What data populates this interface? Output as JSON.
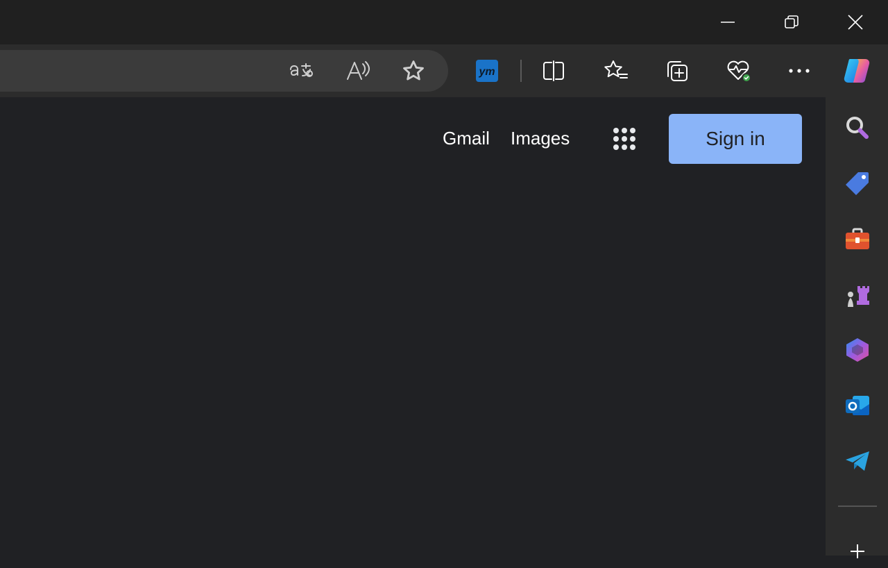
{
  "window_controls": {
    "minimize_icon": "minimize-icon",
    "restore_icon": "restore-icon",
    "close_icon": "close-icon"
  },
  "toolbar": {
    "address_icons": [
      "translate-icon",
      "read-aloud-icon",
      "favorite-star-icon"
    ],
    "extension": {
      "label": "ym",
      "color": "#1a73c8"
    },
    "icons": [
      "split-screen-icon",
      "favorites-icon",
      "collections-icon",
      "browser-essentials-icon",
      "more-icon",
      "copilot-icon"
    ]
  },
  "page": {
    "links": {
      "gmail": "Gmail",
      "images": "Images"
    },
    "apps_icon": "google-apps-icon",
    "sign_in_label": "Sign in",
    "sign_in_color": "#8ab4f8"
  },
  "sidebar": {
    "items": [
      "search-icon",
      "shopping-icon",
      "tools-icon",
      "games-icon",
      "microsoft365-icon",
      "outlook-icon",
      "telegram-icon"
    ],
    "add_icon": "add-icon"
  }
}
